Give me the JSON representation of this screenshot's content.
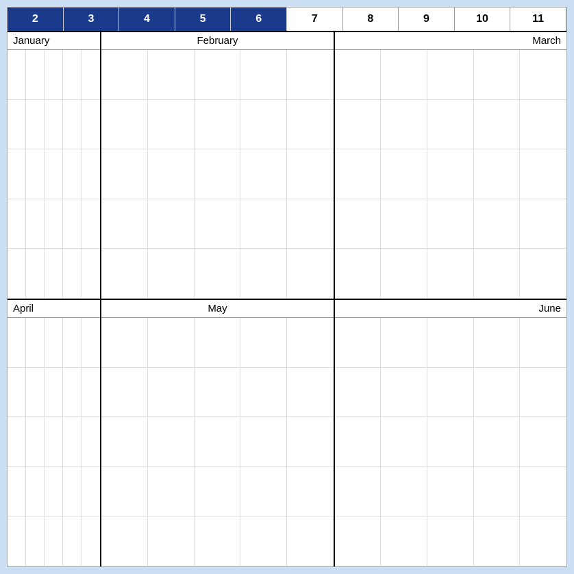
{
  "header": {
    "weeks": [
      {
        "number": "2",
        "highlighted": true
      },
      {
        "number": "3",
        "highlighted": true
      },
      {
        "number": "4",
        "highlighted": true
      },
      {
        "number": "5",
        "highlighted": true
      },
      {
        "number": "6",
        "highlighted": true
      },
      {
        "number": "7",
        "highlighted": false
      },
      {
        "number": "8",
        "highlighted": false
      },
      {
        "number": "9",
        "highlighted": false
      },
      {
        "number": "10",
        "highlighted": false
      },
      {
        "number": "11",
        "highlighted": false
      }
    ]
  },
  "rows": [
    {
      "months": [
        {
          "name": "January",
          "align": "left",
          "widthClass": "narrow"
        },
        {
          "name": "February",
          "align": "center",
          "widthClass": "wide"
        },
        {
          "name": "March",
          "align": "right",
          "widthClass": "wide"
        }
      ]
    },
    {
      "months": [
        {
          "name": "April",
          "align": "left",
          "widthClass": "narrow"
        },
        {
          "name": "May",
          "align": "center",
          "widthClass": "wide"
        },
        {
          "name": "June",
          "align": "right",
          "widthClass": "wide"
        }
      ]
    }
  ]
}
